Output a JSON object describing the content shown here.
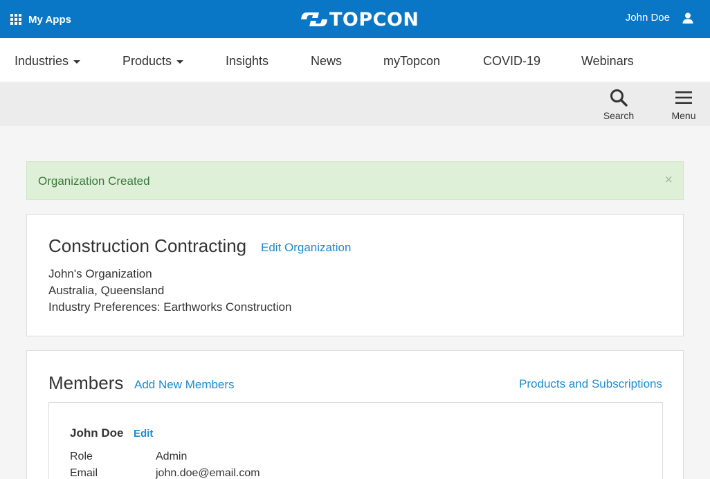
{
  "topbar": {
    "my_apps_label": "My Apps",
    "logo_text": "TOPCON",
    "user_name": "John Doe",
    "bg_color": "#0a77c6",
    "icons": {
      "apps": "grid-icon",
      "user": "user-icon"
    }
  },
  "nav": {
    "items": [
      {
        "label": "Industries",
        "dropdown": true
      },
      {
        "label": "Products",
        "dropdown": true
      },
      {
        "label": "Insights"
      },
      {
        "label": "News"
      },
      {
        "label": "myTopcon"
      },
      {
        "label": "COVID-19"
      },
      {
        "label": "Webinars"
      }
    ]
  },
  "toolbar": {
    "search_label": "Search",
    "menu_label": "Menu"
  },
  "alert": {
    "text": "Organization Created",
    "close": "×",
    "color": "#dff0d8"
  },
  "organization": {
    "name": "Construction Contracting",
    "edit_label": "Edit Organization",
    "owner": "John's Organization",
    "location": "Australia, Queensland",
    "industry": "Industry Preferences: Earthworks Construction"
  },
  "members": {
    "title": "Members",
    "add_label": "Add New Members",
    "products_label": "Products and Subscriptions",
    "list": [
      {
        "name": "John Doe",
        "edit_label": "Edit",
        "role_key": "Role",
        "role_value": "Admin",
        "email_key": "Email",
        "email_value": "john.doe@email.com"
      }
    ]
  },
  "link_color": "#1a8bcf"
}
